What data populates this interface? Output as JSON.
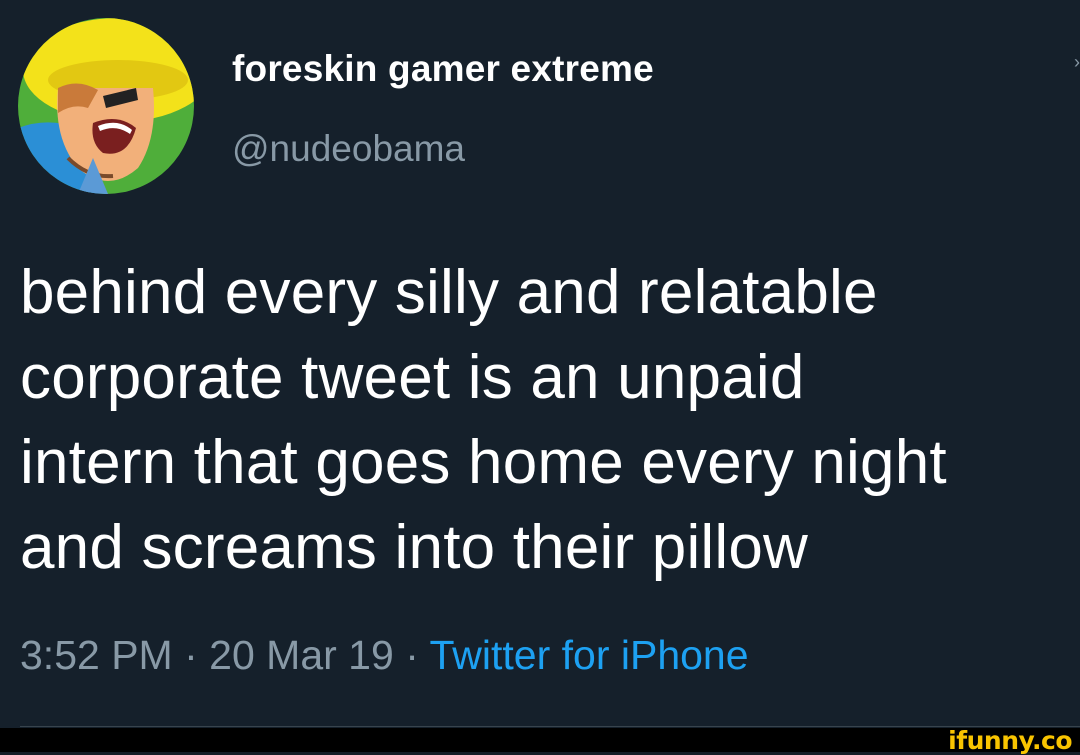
{
  "tweet": {
    "display_name": "foreskin gamer extreme",
    "handle": "@nudeobama",
    "text": "behind every silly and relatable\ncorporate tweet is an unpaid\nintern that goes home every night\nand screams into their pillow",
    "time": "3:52 PM",
    "date": "20 Mar 19",
    "separator": "·",
    "source": "Twitter for iPhone",
    "avatar_icon": "cartoon-avatar"
  },
  "watermark": {
    "text": "ifunny.co"
  },
  "colors": {
    "background": "#15202b",
    "primary_text": "#ffffff",
    "secondary_text": "#8899a6",
    "link": "#1da1f2",
    "watermark": "#f9c400"
  }
}
